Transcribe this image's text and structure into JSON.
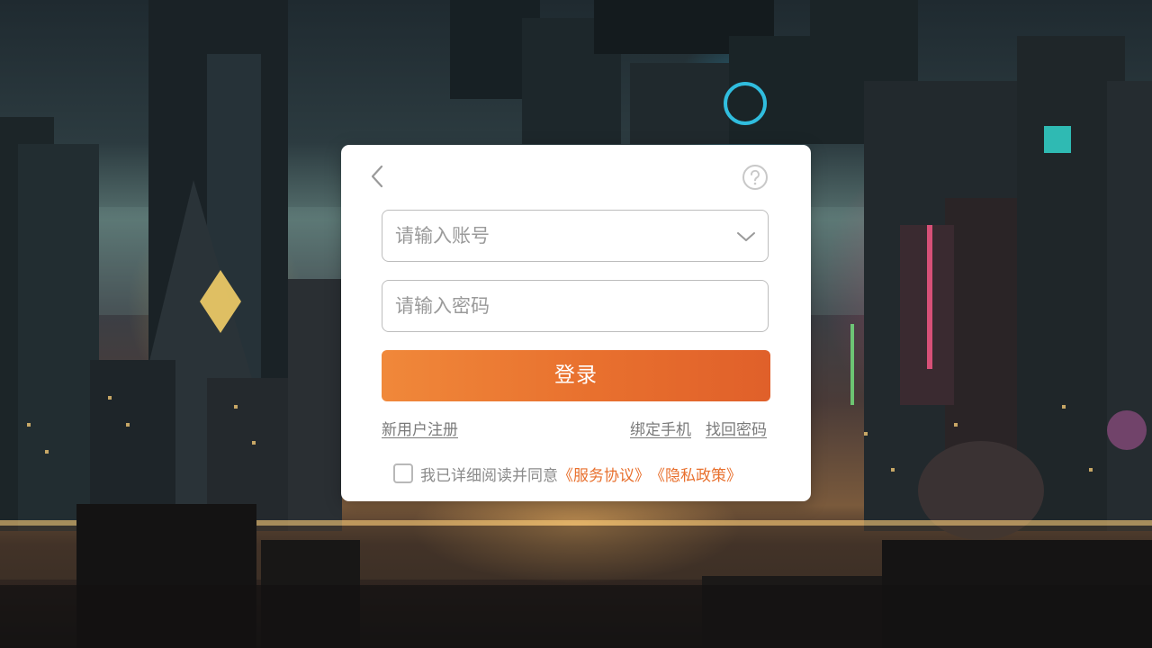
{
  "login": {
    "account_placeholder": "请输入账号",
    "password_placeholder": "请输入密码",
    "login_label": "登录",
    "register_label": "新用户注册",
    "bind_phone_label": "绑定手机",
    "recover_password_label": "找回密码",
    "agree_text": "我已详细阅读并同意",
    "service_agreement_label": "《服务协议》",
    "privacy_policy_label": "《隐私政策》",
    "agreement_checked": false
  },
  "icons": {
    "back": "chevron-left-icon",
    "help": "question-circle-icon",
    "dropdown": "chevron-down-icon"
  },
  "colors": {
    "accent": "#e8702e",
    "button_gradient_start": "#f0883a",
    "button_gradient_end": "#e0602a",
    "link_gray": "#7a7a7a"
  }
}
